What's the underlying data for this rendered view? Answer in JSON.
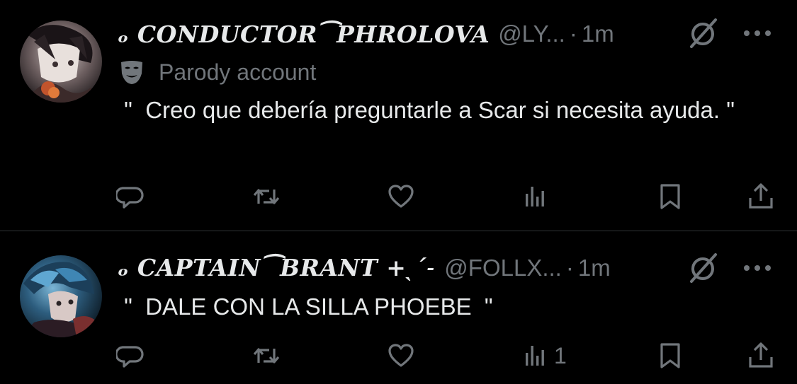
{
  "tweets": [
    {
      "display_name": "ₒ 𝓒𝓞𝓝𝓓𝓤𝓒𝓣𝓞𝓡 ⁀ 𝓟𝓗𝓡𝓞𝓛𝓞𝓥𝓐",
      "display_name_plain": "ₒ CONDUCTOR⁀PHROLOVA",
      "handle": "@LY...",
      "separator": "·",
      "time": "1m",
      "parody_label": "Parody account",
      "text": " \"  Creo que debería preguntarle a Scar si necesita ayuda. \"",
      "actions": {
        "reply_count": "",
        "repost_count": "",
        "like_count": "",
        "views_count": ""
      }
    },
    {
      "display_name": "ₒ 𝓒𝓐𝓟𝓣𝓐𝓘𝓝 ⁀ 𝓑𝓡𝓐𝓝𝓣 +ˎˊ˗",
      "display_name_plain": "ₒ CAPTAIN⁀BRANT +ˎˊ˗",
      "handle": "@FOLLX...",
      "separator": "·",
      "time": "1m",
      "text": " \"  DALE CON LA SILLA PHOEBE  \"",
      "actions": {
        "reply_count": "",
        "repost_count": "",
        "like_count": "",
        "views_count": "1"
      }
    }
  ],
  "icons": {
    "grok": "grok-slash-circle-icon",
    "more": "more-dots-icon",
    "parody": "theater-mask-icon",
    "reply": "reply-bubble-icon",
    "repost": "repost-arrows-icon",
    "like": "heart-icon",
    "views": "bar-chart-icon",
    "bookmark": "bookmark-icon",
    "share": "share-upload-icon"
  },
  "colors": {
    "background": "#000000",
    "primary_text": "#e7e9ea",
    "secondary_text": "#71767b",
    "divider": "#2f3336"
  }
}
